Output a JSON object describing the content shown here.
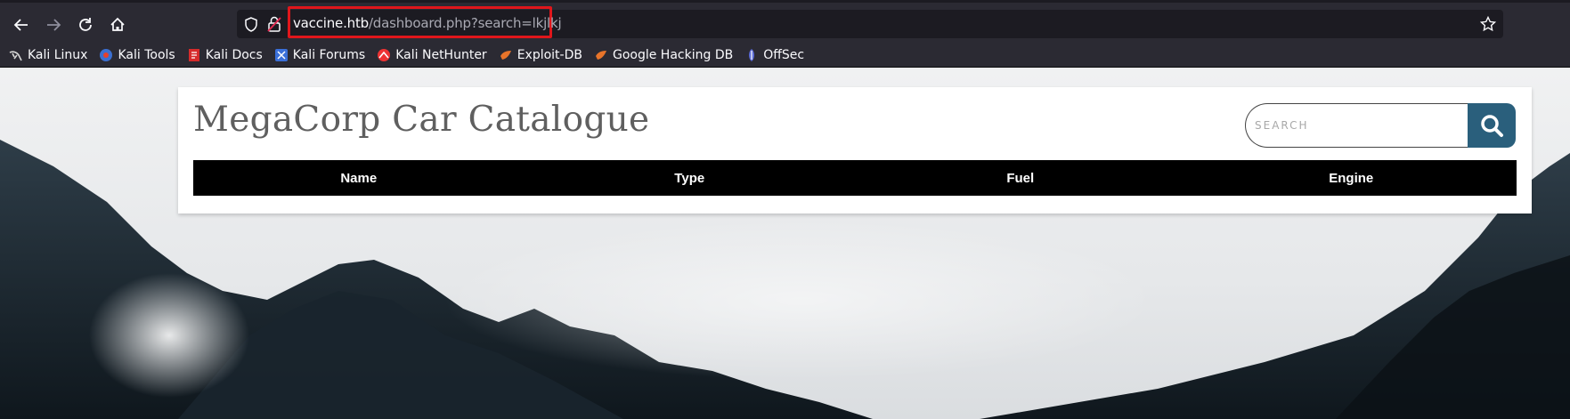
{
  "browser": {
    "url_host": "vaccine.htb",
    "url_path": "/dashboard.php?search=lkjlkj",
    "nav": {
      "back_icon": "back-arrow-icon",
      "forward_icon": "forward-arrow-icon",
      "reload_icon": "reload-icon",
      "home_icon": "home-icon"
    },
    "bookmarks": [
      {
        "label": "Kali Linux",
        "icon": "kali-dragon-icon"
      },
      {
        "label": "Kali Tools",
        "icon": "kali-tools-icon"
      },
      {
        "label": "Kali Docs",
        "icon": "kali-docs-icon"
      },
      {
        "label": "Kali Forums",
        "icon": "kali-forums-icon"
      },
      {
        "label": "Kali NetHunter",
        "icon": "nethunter-icon"
      },
      {
        "label": "Exploit-DB",
        "icon": "exploit-db-icon"
      },
      {
        "label": "Google Hacking DB",
        "icon": "ghdb-icon"
      },
      {
        "label": "OffSec",
        "icon": "offsec-icon"
      }
    ]
  },
  "page": {
    "title": "MegaCorp Car Catalogue",
    "search": {
      "placeholder": "SEARCH",
      "value": ""
    },
    "table": {
      "columns": [
        "Name",
        "Type",
        "Fuel",
        "Engine"
      ],
      "rows": []
    }
  },
  "colors": {
    "highlight": "#e0161b",
    "search_button": "#2a5f7c",
    "chrome": "#2b2a33"
  }
}
